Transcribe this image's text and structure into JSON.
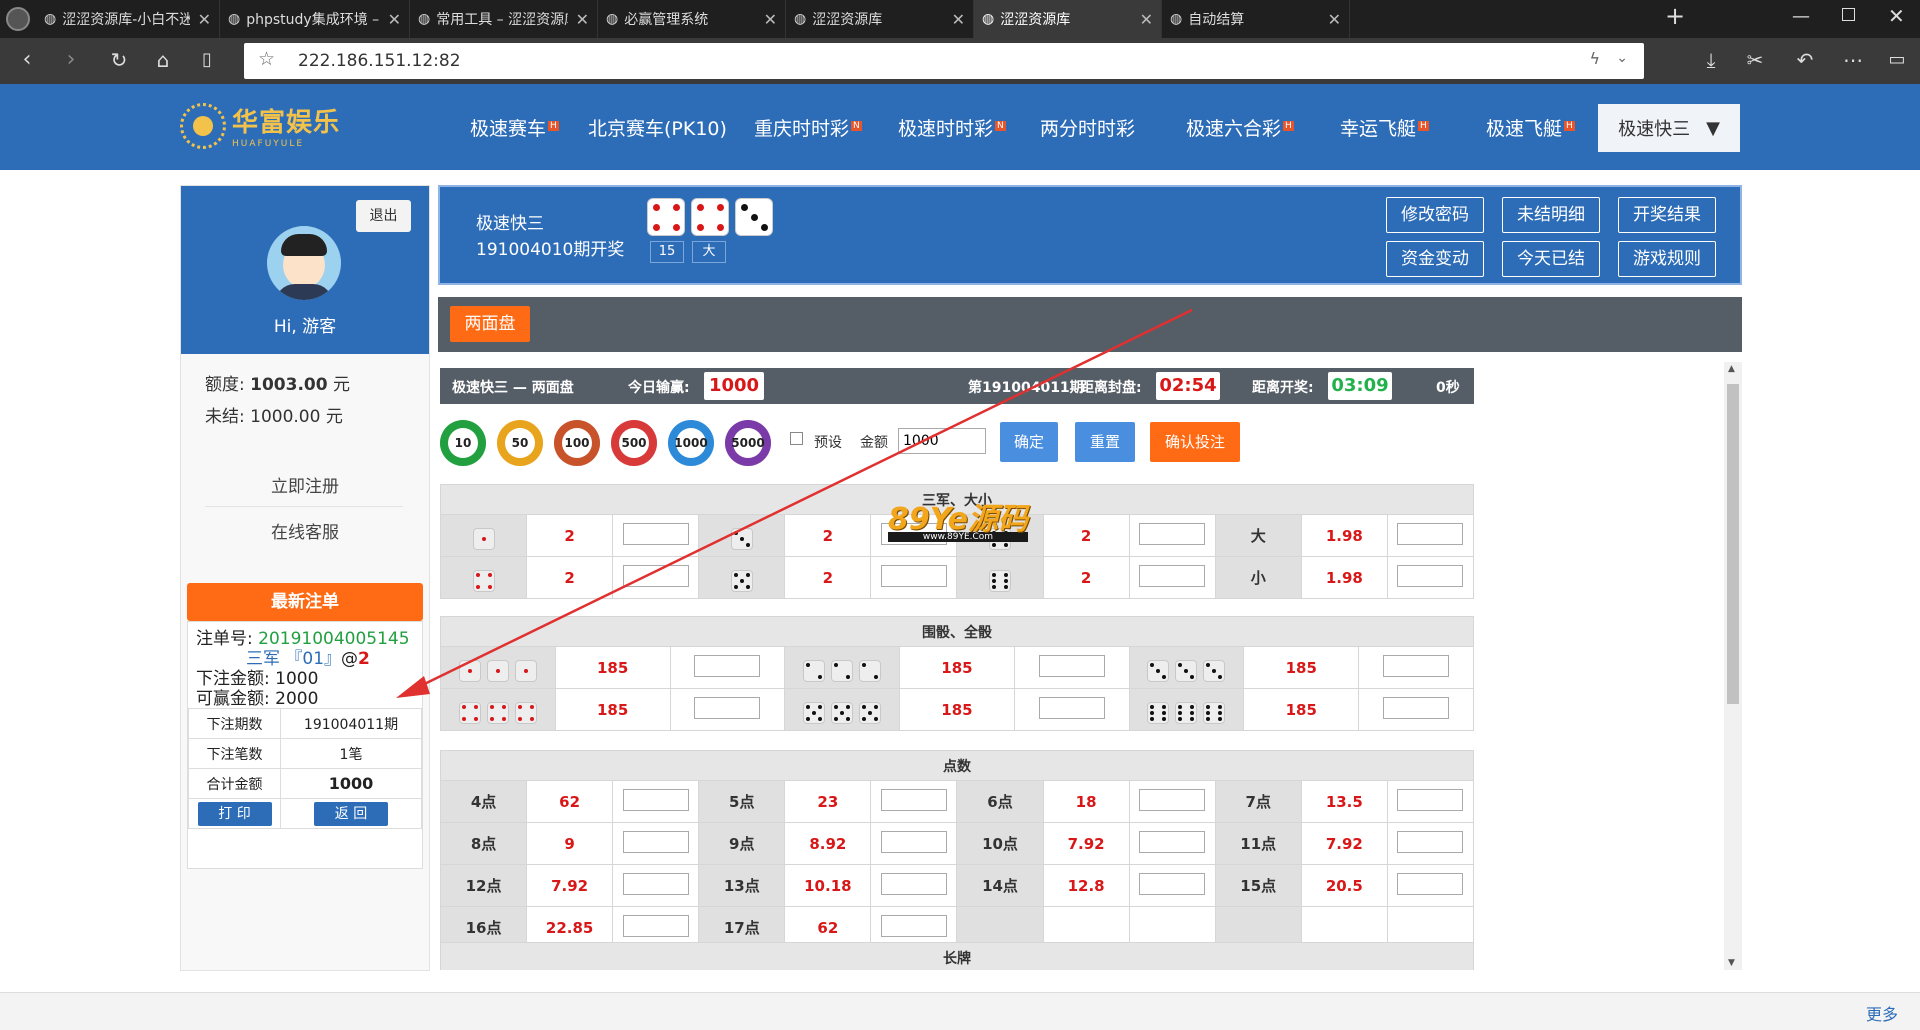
{
  "browser": {
    "tabs": [
      {
        "label": "涩涩资源库-小白不迷路",
        "active": false
      },
      {
        "label": "phpstudy集成环境 – 涩涩",
        "active": false
      },
      {
        "label": "常用工具 – 涩涩资源库",
        "active": false
      },
      {
        "label": "必赢管理系统",
        "active": false
      },
      {
        "label": "涩涩资源库",
        "active": false
      },
      {
        "label": "涩涩资源库",
        "active": true
      },
      {
        "label": "自动结算",
        "active": false
      }
    ],
    "url": "222.186.151.12:82"
  },
  "header": {
    "logo_text": "华富娱乐",
    "logo_sub": "HUAFUYULE",
    "nav": [
      {
        "label": "极速赛车",
        "badge": "H"
      },
      {
        "label": "北京赛车(PK10)",
        "badge": ""
      },
      {
        "label": "重庆时时彩",
        "badge": "N"
      },
      {
        "label": "极速时时彩",
        "badge": "N"
      },
      {
        "label": "两分时时彩",
        "badge": ""
      },
      {
        "label": "极速六合彩",
        "badge": "H"
      },
      {
        "label": "幸运飞艇",
        "badge": "H"
      },
      {
        "label": "极速飞艇",
        "badge": "H"
      }
    ],
    "current_game": "极速快三"
  },
  "sidebar": {
    "logout": "退出",
    "greeting": "Hi, 游客",
    "credit_label": "额度:",
    "credit_value": "1003.00",
    "unsettled_label": "未结:",
    "unsettled_value": "1000.00",
    "currency": "元",
    "register": "立即注册",
    "service": "在线客服",
    "latest_title": "最新注单",
    "order_label": "注单号:",
    "order_no": "20191004005145",
    "bet_desc": "三军 『01』",
    "bet_at": "@",
    "bet_odds": "2",
    "bet_amount_label": "下注金额:",
    "bet_amount": "1000",
    "win_amount_label": "可赢金额:",
    "win_amount": "2000",
    "period_label": "下注期数",
    "period_value": "191004011期",
    "count_label": "下注笔数",
    "count_value": "1笔",
    "total_label": "合计金额",
    "total_value": "1000",
    "print": "打 印",
    "back": "返 回"
  },
  "game": {
    "name": "极速快三",
    "draw": "191004010期开奖",
    "draw_dice": [
      4,
      4,
      3
    ],
    "sum": "15",
    "size": "大",
    "buttons": [
      "修改密码",
      "未结明细",
      "开奖结果",
      "资金变动",
      "今天已结",
      "游戏规则"
    ],
    "tab": "两面盘"
  },
  "info": {
    "title": "极速快三 — 两面盘",
    "today_label": "今日输赢:",
    "today_value": "1000",
    "period": "第191004011期",
    "close_label": "距离封盘:",
    "close_value": "02:54",
    "open_label": "距离开奖:",
    "open_value": "03:09",
    "seconds": "0秒"
  },
  "toolbar": {
    "chips": [
      "10",
      "50",
      "100",
      "500",
      "1000",
      "5000"
    ],
    "preset": "预设",
    "amount_label": "金额",
    "amount_value": "1000",
    "confirm": "确定",
    "reset": "重置",
    "submit": "确认投注"
  },
  "sections": {
    "sanjun": {
      "title": "三军、大小",
      "rows": [
        [
          {
            "die": 1,
            "odds": "2"
          },
          {
            "die": 3,
            "odds": "2"
          },
          {
            "die": 5,
            "odds": "2"
          },
          {
            "label": "大",
            "odds": "1.98"
          }
        ],
        [
          {
            "die": 4,
            "odds": "2"
          },
          {
            "die": 5,
            "odds": "2"
          },
          {
            "die": 6,
            "odds": "2"
          },
          {
            "label": "小",
            "odds": "1.98"
          }
        ]
      ]
    },
    "weishai": {
      "title": "围骰、全骰",
      "rows": [
        [
          {
            "die": 1,
            "odds": "185"
          },
          {
            "die": 2,
            "odds": "185"
          },
          {
            "die": 3,
            "odds": "185"
          }
        ],
        [
          {
            "die": 4,
            "odds": "185"
          },
          {
            "die": 5,
            "odds": "185"
          },
          {
            "die": 6,
            "odds": "185"
          }
        ]
      ]
    },
    "dianshu": {
      "title": "点数",
      "rows": [
        [
          {
            "label": "4点",
            "odds": "62"
          },
          {
            "label": "5点",
            "odds": "23"
          },
          {
            "label": "6点",
            "odds": "18"
          },
          {
            "label": "7点",
            "odds": "13.5"
          }
        ],
        [
          {
            "label": "8点",
            "odds": "9"
          },
          {
            "label": "9点",
            "odds": "8.92"
          },
          {
            "label": "10点",
            "odds": "7.92"
          },
          {
            "label": "11点",
            "odds": "7.92"
          }
        ],
        [
          {
            "label": "12点",
            "odds": "7.92"
          },
          {
            "label": "13点",
            "odds": "10.18"
          },
          {
            "label": "14点",
            "odds": "12.8"
          },
          {
            "label": "15点",
            "odds": "20.5"
          }
        ],
        [
          {
            "label": "16点",
            "odds": "22.85"
          },
          {
            "label": "17点",
            "odds": "62"
          }
        ]
      ]
    },
    "changpai_title": "长牌"
  },
  "watermark": {
    "text": "89Ye源码",
    "sub": "www.89YE.Com"
  },
  "status": {
    "more": "更多"
  },
  "colors": {
    "brand_blue": "#2d6db8",
    "accent_orange": "#ff6a14",
    "odds_red": "#d81818",
    "timer_green": "#22b14c",
    "bar_gray": "#555d66"
  }
}
